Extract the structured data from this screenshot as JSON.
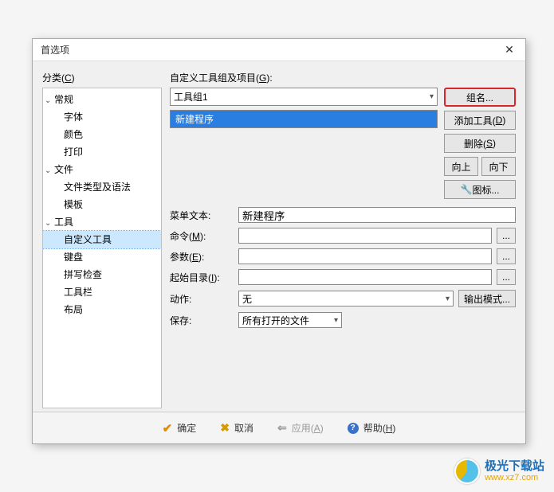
{
  "dialog": {
    "title": "首选项",
    "close": "✕"
  },
  "category": {
    "label_prefix": "分类(",
    "label_hotkey": "C",
    "label_suffix": ")",
    "groups": [
      {
        "name": "常规",
        "children": [
          "字体",
          "颜色",
          "打印"
        ]
      },
      {
        "name": "文件",
        "children": [
          "文件类型及语法",
          "模板"
        ]
      },
      {
        "name": "工具",
        "children": [
          "自定义工具",
          "键盘",
          "拼写检查",
          "工具栏",
          "布局"
        ]
      }
    ],
    "selected": "自定义工具"
  },
  "right": {
    "group_label_prefix": "自定义工具组及项目(",
    "group_label_hotkey": "G",
    "group_label_suffix": "):",
    "group_dropdown_value": "工具组1",
    "list_items": [
      "新建程序"
    ],
    "buttons": {
      "group_name": "组名...",
      "add_tool_prefix": "添加工具(",
      "add_tool_hotkey": "D",
      "add_tool_suffix": ")",
      "delete_prefix": "删除(",
      "delete_hotkey": "S",
      "delete_suffix": ")",
      "move_up": "向上",
      "move_down": "向下",
      "icon": "图标..."
    },
    "form": {
      "menu_text_label": "菜单文本:",
      "menu_text_value": "新建程序",
      "command_label_prefix": "命令(",
      "command_label_hotkey": "M",
      "command_label_suffix": "):",
      "command_value": "",
      "args_label_prefix": "参数(",
      "args_label_hotkey": "E",
      "args_label_suffix": "):",
      "args_value": "",
      "startdir_label_prefix": "起始目录(",
      "startdir_label_hotkey": "I",
      "startdir_label_suffix": "):",
      "startdir_value": "",
      "action_label": "动作:",
      "action_value": "无",
      "output_mode": "输出模式...",
      "save_label": "保存:",
      "save_value": "所有打开的文件",
      "browse": "..."
    }
  },
  "footer": {
    "ok": "确定",
    "cancel": "取消",
    "apply_prefix": "应用(",
    "apply_hotkey": "A",
    "apply_suffix": ")",
    "help_prefix": "帮助(",
    "help_hotkey": "H",
    "help_suffix": ")"
  },
  "watermark": {
    "cn": "极光下载站",
    "en": "www.xz7.com"
  }
}
